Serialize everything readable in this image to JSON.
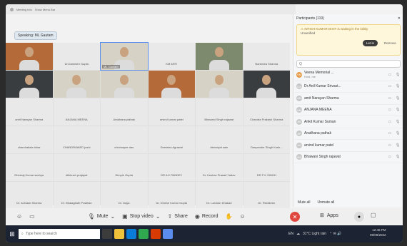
{
  "titlebar": {
    "items": [
      "Meeting info",
      "Show Menu Bar"
    ]
  },
  "speaking": "Speaking: ML Gautam",
  "grid": {
    "tiles": [
      {
        "name": "",
        "video": true,
        "tone": "warm"
      },
      {
        "name": "Dr.Dameshr Gupta",
        "video": false
      },
      {
        "name": "ML Gautam",
        "video": true,
        "tone": "light",
        "sel": true
      },
      {
        "name": "KM ARTI",
        "video": false
      },
      {
        "name": "",
        "video": true,
        "tone": "green"
      },
      {
        "name": "Narendra Sharma",
        "video": false
      },
      {
        "name": "",
        "video": true,
        "tone": "dark"
      },
      {
        "name": "",
        "video": true,
        "tone": "light"
      },
      {
        "name": "",
        "video": true,
        "tone": "light"
      },
      {
        "name": "",
        "video": true,
        "tone": "warm"
      },
      {
        "name": "",
        "video": true,
        "tone": "light"
      },
      {
        "name": "",
        "video": true,
        "tone": "dark"
      },
      {
        "name": "amit Narayan Sharma",
        "video": false
      },
      {
        "name": "ANJANA MEENA",
        "video": false
      },
      {
        "name": "Aradhana pathak",
        "video": false
      },
      {
        "name": "arvind kumar patel",
        "video": false
      },
      {
        "name": "Bhawani Singh rajawat",
        "video": false
      },
      {
        "name": "Chandra Prakash Sharma",
        "video": false
      },
      {
        "name": "chandrakala lohar",
        "video": false
      },
      {
        "name": "CHANDRAWATI joshi",
        "video": false
      },
      {
        "name": "chinmayee das",
        "video": false
      },
      {
        "name": "Deeksha Agrawal",
        "video": false
      },
      {
        "name": "deendyal sain",
        "video": false
      },
      {
        "name": "Deepender Singh Kush...",
        "video": false
      },
      {
        "name": "Dheeraj Kumar sachya",
        "video": false
      },
      {
        "name": "dilkhush prajapat",
        "video": false
      },
      {
        "name": "Dimple Gupta",
        "video": false
      },
      {
        "name": "DR A K PANDEY",
        "video": false
      },
      {
        "name": "Dr. Keshav Prasad Yadav",
        "video": false
      },
      {
        "name": "DR P K SINGH",
        "video": false
      },
      {
        "name": "Dr. Avinash Sharma",
        "video": false
      },
      {
        "name": "Dr. Bhalagirath Pradhan",
        "video": false
      },
      {
        "name": "Dr. Daya",
        "video": false
      },
      {
        "name": "Dr. Dinesh Kumar Gupta",
        "video": false
      },
      {
        "name": "Dr. Laxman Dhakad",
        "video": false
      },
      {
        "name": "Dr. Rishikesh",
        "video": false
      }
    ]
  },
  "controls": {
    "mute": "Mute",
    "stop_video": "Stop video",
    "share": "Share",
    "record": "Record"
  },
  "panel": {
    "title": "Participants (119)",
    "waiting_name": "NITISH KUMAR DIXIT",
    "waiting_text": "is waiting in the lobby",
    "waiting_status": "Unverified",
    "let_in": "Let in",
    "remove": "Remove",
    "search_placeholder": "Q",
    "participants": [
      {
        "name": "Veena Memorial ...",
        "sub": "Host, me",
        "initials": "VM",
        "host": true
      },
      {
        "name": "Dr Anil Kumar Srivast...",
        "sub": "",
        "initials": "DA"
      },
      {
        "name": "amit Narayan Sharma",
        "sub": "",
        "initials": "AN"
      },
      {
        "name": "ANJANA MEENA",
        "sub": "",
        "initials": "AM"
      },
      {
        "name": "Ankit Kumar Suman",
        "sub": "",
        "initials": "AK"
      },
      {
        "name": "Aradhana pathak",
        "sub": "",
        "initials": "AP"
      },
      {
        "name": "arvind kumar patel",
        "sub": "",
        "initials": "AK"
      },
      {
        "name": "Bhawani Singh rajawat",
        "sub": "",
        "initials": "BS"
      }
    ],
    "mute_all": "Mute all",
    "unmute_all": "Unmute all"
  },
  "apps_label": "Apps",
  "taskbar": {
    "search": "Type here to search",
    "lang": "EN",
    "weather": "31°C Light rain",
    "time": "12:46 PM",
    "date": "09/09/2022"
  },
  "colors": {
    "leave": "#e0473f",
    "panel_bg": "#f5f6f7",
    "waiting_bg": "#fff7dc"
  }
}
